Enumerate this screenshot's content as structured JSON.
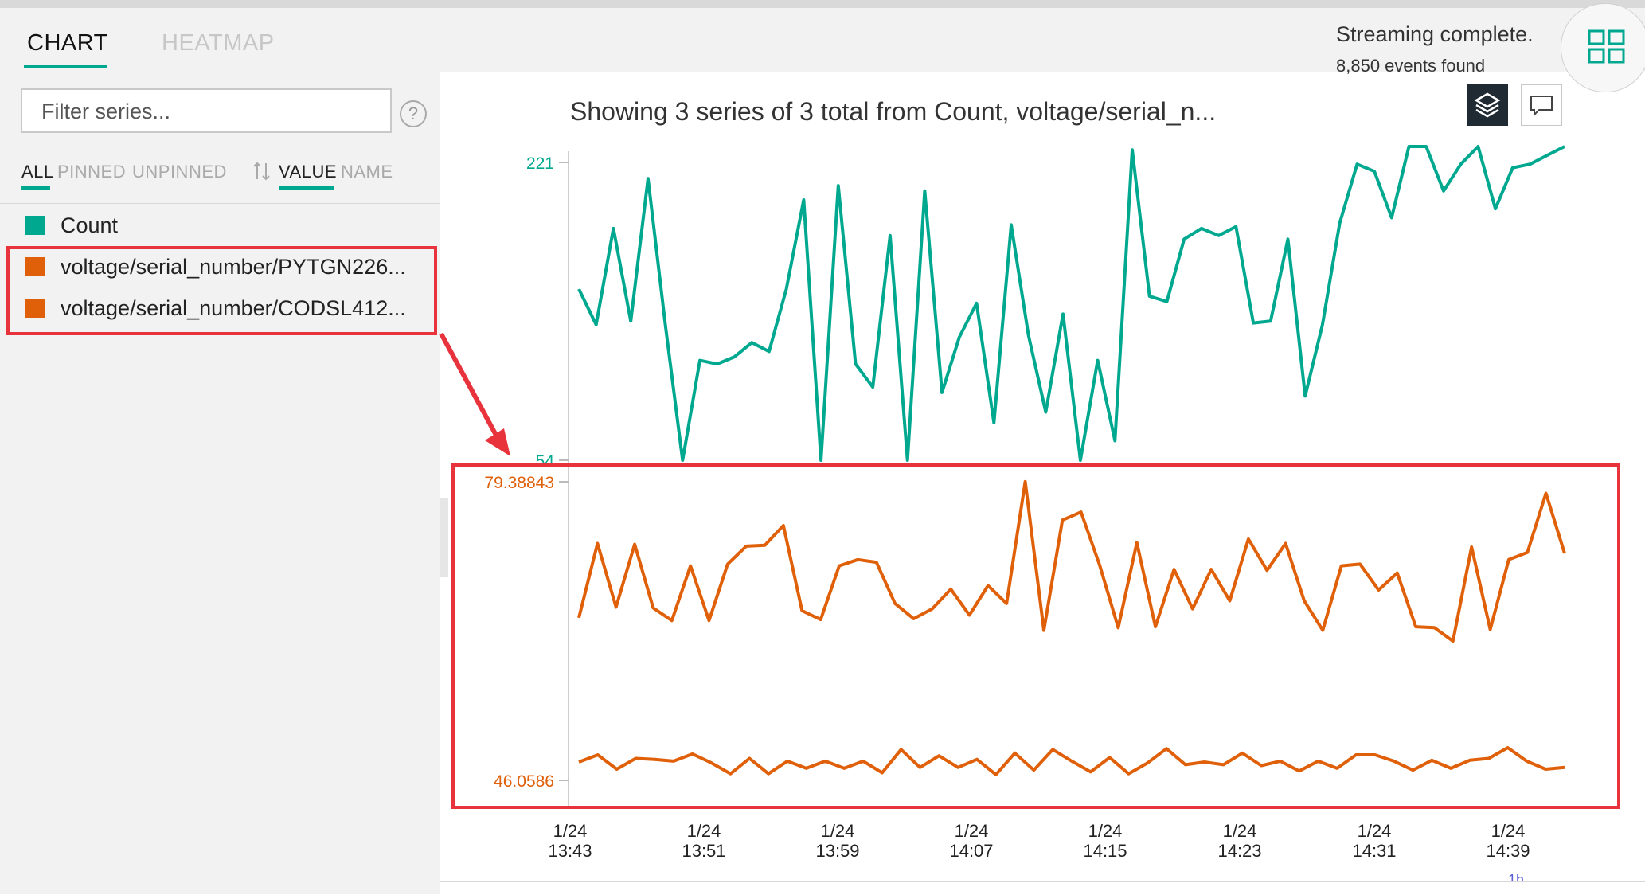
{
  "tabs": {
    "chart": "CHART",
    "heatmap": "HEATMAP"
  },
  "status": {
    "line1": "Streaming complete.",
    "line2": "8,850 events found"
  },
  "sidebar": {
    "filter_placeholder": "Filter series...",
    "help_icon": "?",
    "filters": {
      "all": "ALL",
      "pinned": "PINNED",
      "unpinned": "UNPINNED"
    },
    "sort": {
      "value": "VALUE",
      "name": "NAME"
    },
    "series": [
      {
        "label": "Count",
        "color": "#00a88f"
      },
      {
        "label": "voltage/serial_number/PYTGN226...",
        "color": "#e0600a"
      },
      {
        "label": "voltage/serial_number/CODSL412...",
        "color": "#e0600a"
      }
    ]
  },
  "main": {
    "title": "Showing 3 series of 3 total from Count, voltage/serial_n..."
  },
  "interval_tag": "1h",
  "colors": {
    "accent": "#00a88f",
    "orange": "#e0600a",
    "highlight": "#e8323c"
  },
  "chart_data": {
    "type": "line",
    "x_tick_labels": [
      [
        "1/24",
        "13:43"
      ],
      [
        "1/24",
        "13:51"
      ],
      [
        "1/24",
        "13:59"
      ],
      [
        "1/24",
        "14:07"
      ],
      [
        "1/24",
        "14:15"
      ],
      [
        "1/24",
        "14:23"
      ],
      [
        "1/24",
        "14:31"
      ],
      [
        "1/24",
        "14:39"
      ]
    ],
    "panels": [
      {
        "axis_labels": [
          "221",
          "54"
        ],
        "ylim": [
          54,
          221
        ],
        "color": "#00a88f",
        "series": [
          {
            "values": [
              150,
              130,
              184,
              132,
              212,
              130,
              54,
              110,
              108,
              112,
              120,
              115,
              150,
              200,
              54,
              208,
              108,
              95,
              180,
              54,
              205,
              92,
              123,
              142,
              75,
              186,
              124,
              81,
              136,
              54,
              110,
              65,
              228,
              146,
              143,
              178,
              184,
              180,
              185,
              131,
              132,
              178,
              90,
              130,
              187,
              220,
              216,
              190,
              235,
              240,
              205,
              220,
              235,
              195,
              218,
              220,
              225,
              240
            ]
          }
        ]
      },
      {
        "axis_labels": [
          "79.38843",
          "46.0586"
        ],
        "ylim": [
          46.0586,
          79.38843
        ],
        "color": "#e0600a",
        "series": [
          {
            "values": [
              64.2,
              72.5,
              65.4,
              72.4,
              65.3,
              63.9,
              70.0,
              63.9,
              70.2,
              72.2,
              72.3,
              74.5,
              65.0,
              64.0,
              70.0,
              70.7,
              70.4,
              65.8,
              64.1,
              65.2,
              67.4,
              64.5,
              67.8,
              65.8,
              79.4,
              62.8,
              75.1,
              76.0,
              70.1,
              63.1,
              72.6,
              63.2,
              69.6,
              65.2,
              69.6,
              66.1,
              73.0,
              69.5,
              72.5,
              66.1,
              62.8,
              70.0,
              70.2,
              67.3,
              69.2,
              63.2,
              63.1,
              61.6,
              72.1,
              62.9,
              70.7,
              71.5,
              78.1,
              71.4
            ]
          },
          {
            "values": [
              48.1,
              48.9,
              47.3,
              48.5,
              48.4,
              48.2,
              49.0,
              48.0,
              46.8,
              48.5,
              46.8,
              48.2,
              47.4,
              48.2,
              47.4,
              48.2,
              46.9,
              49.5,
              47.5,
              48.8,
              47.5,
              48.4,
              46.7,
              49.1,
              47.2,
              49.5,
              48.2,
              47.0,
              48.6,
              46.8,
              48.0,
              49.6,
              47.8,
              48.1,
              47.8,
              49.1,
              47.7,
              48.2,
              47.1,
              48.2,
              47.4,
              48.9,
              48.9,
              48.2,
              47.2,
              48.3,
              47.4,
              48.3,
              48.5,
              49.7,
              48.2,
              47.3,
              47.5
            ]
          }
        ]
      }
    ]
  }
}
